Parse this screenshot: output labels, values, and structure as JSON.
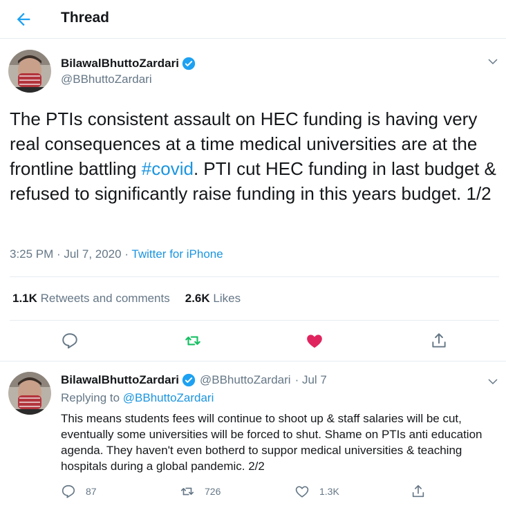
{
  "header": {
    "title": "Thread"
  },
  "tweet": {
    "author_name": "BilawalBhuttoZardari",
    "author_handle": "@BBhuttoZardari",
    "text_part1": "The PTIs consistent assault on HEC funding is having very real consequences at a time medical universities are at the frontline battling ",
    "hashtag": "#covid",
    "text_part2": ". PTI cut HEC funding in last budget & refused to significantly raise funding in this years budget. 1/2",
    "time_date": "3:25 PM · Jul 7, 2020 · ",
    "source": "Twitter for iPhone",
    "retweets_count": "1.1K",
    "retweets_label": "Retweets and comments",
    "likes_count": "2.6K",
    "likes_label": "Likes"
  },
  "reply": {
    "author_name": "BilawalBhuttoZardari",
    "author_handle": "@BBhuttoZardari",
    "date": "· Jul 7",
    "replying_label": "Replying to ",
    "replying_handle": "@BBhuttoZardari",
    "text": "This means students fees will continue to shoot up & staff salaries will be cut, eventually some universities will be forced to shut. Shame on PTIs anti education agenda. They haven't even botherd to suppor medical universities & teaching hospitals during a global pandemic. 2/2",
    "replies_count": "87",
    "retweets_count": "726",
    "likes_count": "1.3K"
  },
  "colors": {
    "accent": "#1da1f2",
    "retweet": "#17bf63",
    "like": "#e0245e",
    "muted": "#657786"
  },
  "icons": [
    "back-arrow-icon",
    "verified-badge-icon",
    "chevron-down-icon",
    "reply-icon",
    "retweet-icon",
    "heart-icon",
    "share-icon"
  ]
}
